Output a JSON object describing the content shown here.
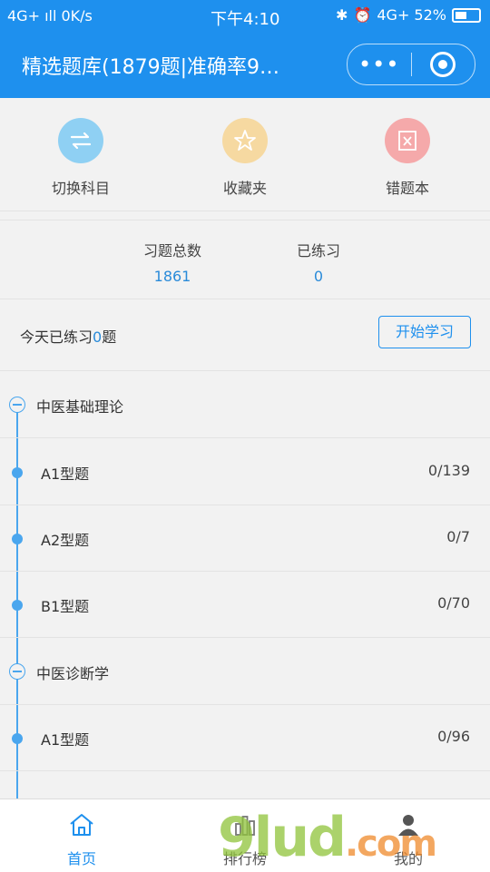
{
  "status_bar": {
    "left": "4G+ ıll  0K/s",
    "time": "下午4:10",
    "right": "4G+ 52%"
  },
  "nav": {
    "title": "精选题库(1879题|准确率9…",
    "more": "•••"
  },
  "quick_actions": [
    {
      "label": "切换科目",
      "icon": "switch-icon",
      "color": "#8fd0f3"
    },
    {
      "label": "收藏夹",
      "icon": "star-icon",
      "color": "#f6d9a1"
    },
    {
      "label": "错题本",
      "icon": "wrong-book-icon",
      "color": "#f5a9aa"
    }
  ],
  "stats": {
    "total_label": "习题总数",
    "total_value": "1861",
    "practiced_label": "已练习",
    "practiced_value": "0"
  },
  "today": {
    "prefix": "今天已练习",
    "count": "0",
    "suffix": "题",
    "button": "开始学习"
  },
  "tree": {
    "sections": [
      {
        "title": "中医基础理论",
        "items": [
          {
            "label": "A1型题",
            "count": "0/139"
          },
          {
            "label": "A2型题",
            "count": "0/7"
          },
          {
            "label": "B1型题",
            "count": "0/70"
          }
        ]
      },
      {
        "title": "中医诊断学",
        "items": [
          {
            "label": "A1型题",
            "count": "0/96"
          }
        ]
      }
    ]
  },
  "tabbar": [
    {
      "label": "首页",
      "icon": "home-icon",
      "active": true
    },
    {
      "label": "排行榜",
      "icon": "ranking-icon",
      "active": false
    },
    {
      "label": "我的",
      "icon": "user-icon",
      "active": false
    }
  ],
  "watermark": {
    "main": "9lud",
    "suffix": ".com"
  },
  "colors": {
    "primary": "#1e90ee",
    "accent_text": "#2a8bd9"
  }
}
